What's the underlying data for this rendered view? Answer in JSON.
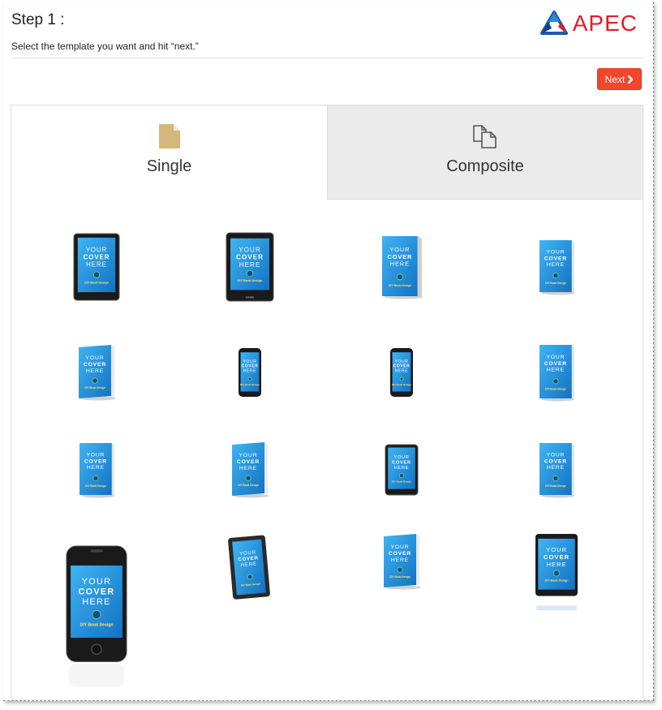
{
  "header": {
    "title": "Step 1 :",
    "subtitle": "Select the template you want and hit “next.”",
    "logo_text": "APEC",
    "logo_icon": "apec-triangle-logo"
  },
  "toolbar": {
    "next_label": "Next",
    "next_icon": "chevron-right-icon",
    "next_color": "#f1472b"
  },
  "tabs": [
    {
      "label": "Single",
      "icon": "single-page-icon",
      "active": true,
      "icon_color": "#d4b77a"
    },
    {
      "label": "Composite",
      "icon": "multi-page-icon",
      "active": false,
      "icon_color": "#555555"
    }
  ],
  "cover_text": {
    "line1": "YOUR",
    "line2": "COVER",
    "line3": "HERE",
    "brand": "DIY Book Design"
  },
  "colors": {
    "cover_blue": "#1f9be6",
    "device_black": "#1a1a1a",
    "accent_red": "#e21b2a"
  },
  "templates": [
    {
      "type": "tablet"
    },
    {
      "type": "ereader"
    },
    {
      "type": "hardcover"
    },
    {
      "type": "book-standing"
    },
    {
      "type": "paperback-angled"
    },
    {
      "type": "phone-small"
    },
    {
      "type": "phone-small"
    },
    {
      "type": "book-flat"
    },
    {
      "type": "book-standing"
    },
    {
      "type": "paperback-angled"
    },
    {
      "type": "tablet-small"
    },
    {
      "type": "book-standing"
    },
    {
      "type": "iphone-large"
    },
    {
      "type": "tablet-tilted"
    },
    {
      "type": "paperback-angled"
    },
    {
      "type": "ipad-reflect"
    }
  ]
}
